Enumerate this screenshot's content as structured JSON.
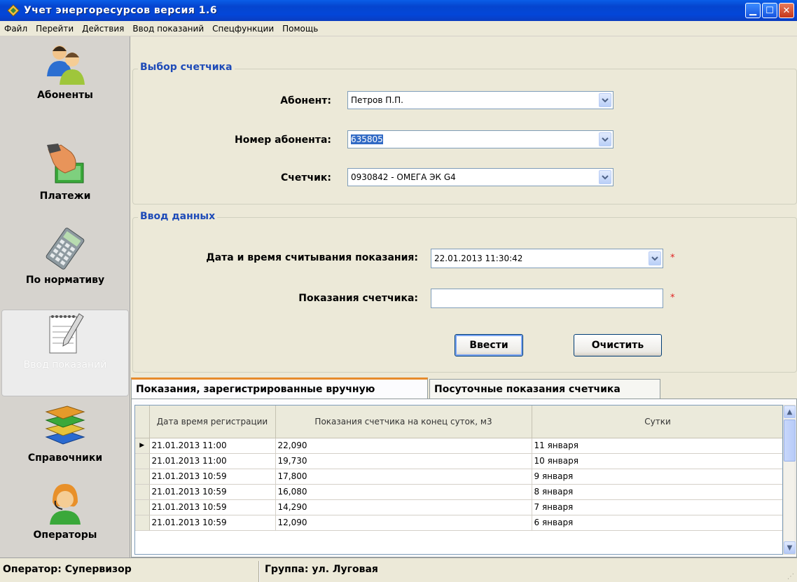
{
  "window": {
    "title": "Учет энергоресурсов версия 1.6"
  },
  "menu": [
    "Файл",
    "Перейти",
    "Действия",
    "Ввод показаний",
    "Спецфункции",
    "Помощь"
  ],
  "sidebar": {
    "items": [
      {
        "label": "Абоненты",
        "icon": "users-icon"
      },
      {
        "label": "Платежи",
        "icon": "payment-hand-icon"
      },
      {
        "label": "По нормативу",
        "icon": "calculator-icon"
      },
      {
        "label": "Ввод показаний",
        "icon": "notepad-pencil-icon",
        "active": true
      },
      {
        "label": "Справочники",
        "icon": "books-icon"
      },
      {
        "label": "Операторы",
        "icon": "operator-headset-icon"
      }
    ]
  },
  "meter_select": {
    "title": "Выбор счетчика",
    "subscriber_label": "Абонент:",
    "subscriber_value": "Петров П.П.",
    "number_label": "Номер абонента:",
    "number_value": "635805",
    "meter_label": "Счетчик:",
    "meter_value": "0930842 - ОМЕГА ЭК G4"
  },
  "data_entry": {
    "title": "Ввод данных",
    "datetime_label": "Дата и время считывания показания:",
    "datetime_value": "22.01.2013 11:30:42",
    "reading_label": "Показания счетчика:",
    "reading_value": "",
    "required_mark": "*",
    "submit_label": "Ввести",
    "clear_label": "Очистить"
  },
  "tabs": [
    {
      "label": "Показания, зарегистрированные вручную",
      "active": true
    },
    {
      "label": "Посуточные показания счетчика",
      "active": false
    }
  ],
  "grid": {
    "columns": [
      "Дата время регистрации",
      "Показания счетчика на конец суток, м3",
      "Сутки"
    ],
    "rows": [
      [
        "21.01.2013 11:00",
        "22,090",
        "11 января"
      ],
      [
        "21.01.2013 11:00",
        "19,730",
        "10 января"
      ],
      [
        "21.01.2013 10:59",
        "17,800",
        "9 января"
      ],
      [
        "21.01.2013 10:59",
        "16,080",
        "8 января"
      ],
      [
        "21.01.2013 10:59",
        "14,290",
        "7 января"
      ],
      [
        "21.01.2013 10:59",
        "12,090",
        "6 января"
      ]
    ]
  },
  "status": {
    "operator": "Оператор: Супервизор",
    "group": "Группа: ул. Луговая"
  }
}
